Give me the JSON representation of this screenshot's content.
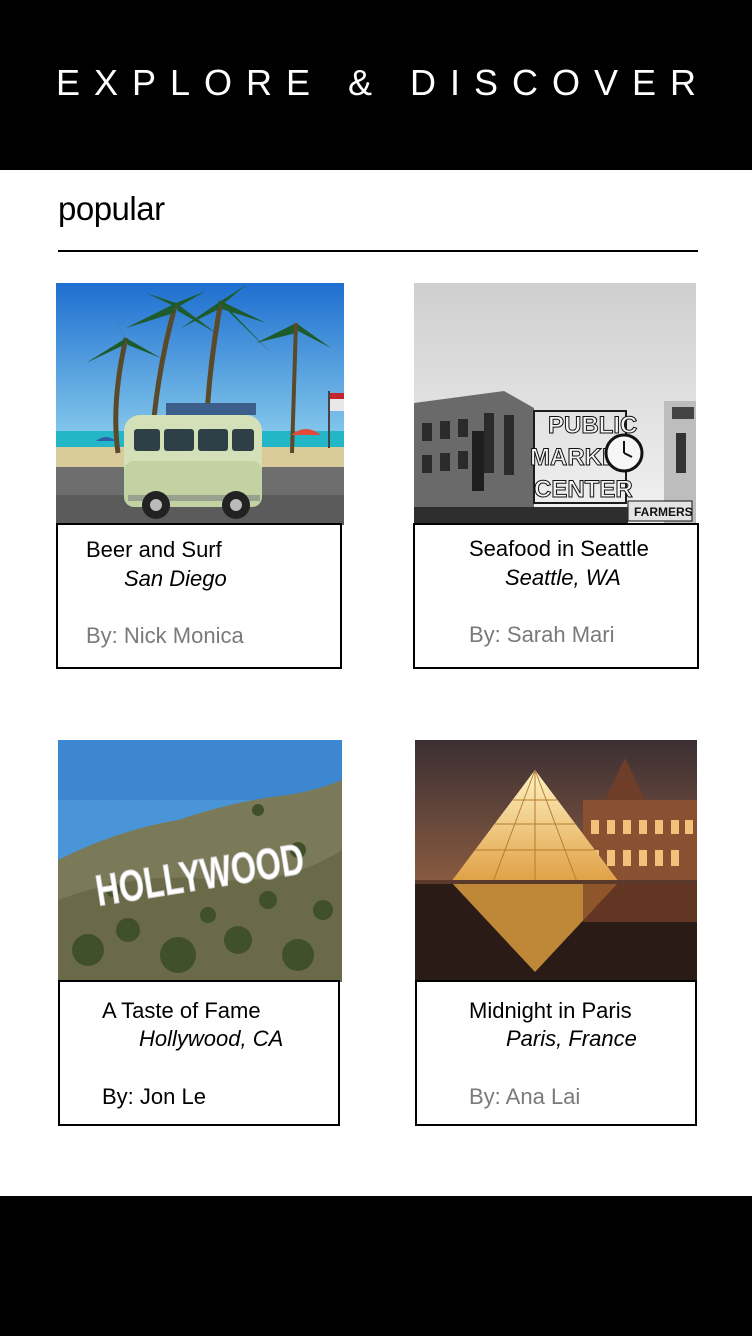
{
  "header": {
    "title": "EXPLORE & DISCOVER"
  },
  "section": {
    "title": "popular"
  },
  "cards": [
    {
      "title": "Beer and Surf",
      "location": "San Diego",
      "author": "By: Nick Monica",
      "image": "vw-van-beach-photo"
    },
    {
      "title": "Seafood in Seattle",
      "location": "Seattle, WA",
      "author": "By: Sarah Mari",
      "image": "public-market-center-photo"
    },
    {
      "title": "A Taste of Fame",
      "location": "Hollywood, CA",
      "author": "By: Jon Le",
      "image": "hollywood-sign-photo"
    },
    {
      "title": "Midnight in Paris",
      "location": "Paris, France",
      "author": "By: Ana Lai",
      "image": "louvre-pyramid-photo"
    }
  ],
  "photo_text": {
    "market_sign_lines": [
      "PUBLIC",
      "MARKET",
      "CENTER"
    ],
    "farmers_sign": "FARMERS",
    "hollywood_sign": "HOLLYWOOD"
  },
  "colors": {
    "header_bg": "#000000",
    "footer_bg": "#000000",
    "author_gray": "#7a7a7a"
  }
}
